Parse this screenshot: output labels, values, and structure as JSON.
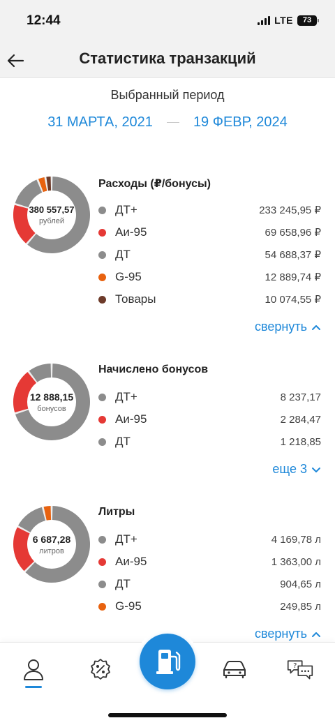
{
  "status": {
    "time": "12:44",
    "network": "LTE",
    "battery": "73"
  },
  "header": {
    "title": "Статистика транзакций"
  },
  "period": {
    "label": "Выбранный период",
    "from": "31 МАРТА, 2021",
    "to": "19 ФЕВР, 2024"
  },
  "colors": {
    "accent": "#1e88d9",
    "gray": "#8c8c8c",
    "red": "#e53935",
    "orange": "#e8620f",
    "brown": "#6d3b2a",
    "green": "#6fd16a"
  },
  "expenses": {
    "title": "Расходы (₽/бонусы)",
    "total": "380 557,57",
    "unit": "рублей",
    "items": [
      {
        "label": "ДТ+",
        "value": "233 245,95 ₽",
        "amount": 233245.95,
        "color": "#8c8c8c"
      },
      {
        "label": "Аи-95",
        "value": "69 658,96 ₽",
        "amount": 69658.96,
        "color": "#e53935"
      },
      {
        "label": "ДТ",
        "value": "54 688,37 ₽",
        "amount": 54688.37,
        "color": "#8c8c8c"
      },
      {
        "label": "G-95",
        "value": "12 889,74 ₽",
        "amount": 12889.74,
        "color": "#e8620f"
      },
      {
        "label": "Товары",
        "value": "10 074,55 ₽",
        "amount": 10074.55,
        "color": "#6d3b2a"
      }
    ],
    "toggle": "свернуть"
  },
  "bonuses": {
    "title": "Начислено бонусов",
    "total": "12 888,15",
    "unit": "бонусов",
    "items": [
      {
        "label": "ДТ+",
        "value": "8 237,17",
        "amount": 8237.17,
        "color": "#8c8c8c"
      },
      {
        "label": "Аи-95",
        "value": "2 284,47",
        "amount": 2284.47,
        "color": "#e53935"
      },
      {
        "label": "ДТ",
        "value": "1 218,85",
        "amount": 1218.85,
        "color": "#8c8c8c"
      }
    ],
    "toggle": "еще 3"
  },
  "liters": {
    "title": "Литры",
    "total": "6 687,28",
    "unit": "литров",
    "items": [
      {
        "label": "ДТ+",
        "value": "4 169,78 л",
        "amount": 4169.78,
        "color": "#8c8c8c"
      },
      {
        "label": "Аи-95",
        "value": "1 363,00 л",
        "amount": 1363.0,
        "color": "#e53935"
      },
      {
        "label": "ДТ",
        "value": "904,65 л",
        "amount": 904.65,
        "color": "#8c8c8c"
      },
      {
        "label": "G-95",
        "value": "249,85 л",
        "amount": 249.85,
        "color": "#e8620f"
      }
    ],
    "toggle": "свернуть"
  },
  "tabbar": {
    "tabs": [
      {
        "icon": "profile-icon",
        "active": true
      },
      {
        "icon": "discount-icon",
        "active": false
      },
      {
        "icon": "fuel-pump-icon",
        "active": false
      },
      {
        "icon": "car-icon",
        "active": false
      },
      {
        "icon": "chat-support-icon",
        "active": false
      }
    ]
  }
}
